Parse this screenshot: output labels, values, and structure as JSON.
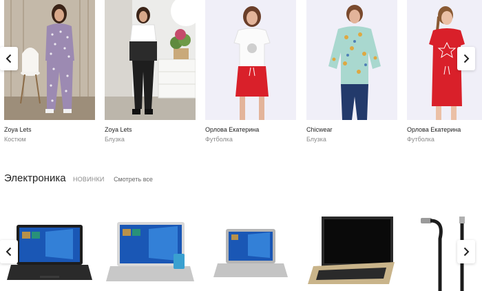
{
  "fashion": {
    "cards": [
      {
        "brand": "Zoya Lets",
        "type": "Костюм"
      },
      {
        "brand": "Zoya Lets",
        "type": "Блузка"
      },
      {
        "brand": "Орлова Екатерина",
        "type": "Футболка"
      },
      {
        "brand": "Chicwear",
        "type": "Блузка"
      },
      {
        "brand": "Орлова Екатерина",
        "type": "Футболка"
      }
    ]
  },
  "electronics": {
    "title": "Электроника",
    "tag": "НОВИНКИ",
    "see_all": "Смотреть все"
  },
  "icons": {
    "prev": "chevron-left-icon",
    "next": "chevron-right-icon"
  },
  "colors": {
    "photo_bg": "#f0eff8",
    "skirt_red": "#d9202a",
    "screen_blue": "#1a57b5"
  }
}
